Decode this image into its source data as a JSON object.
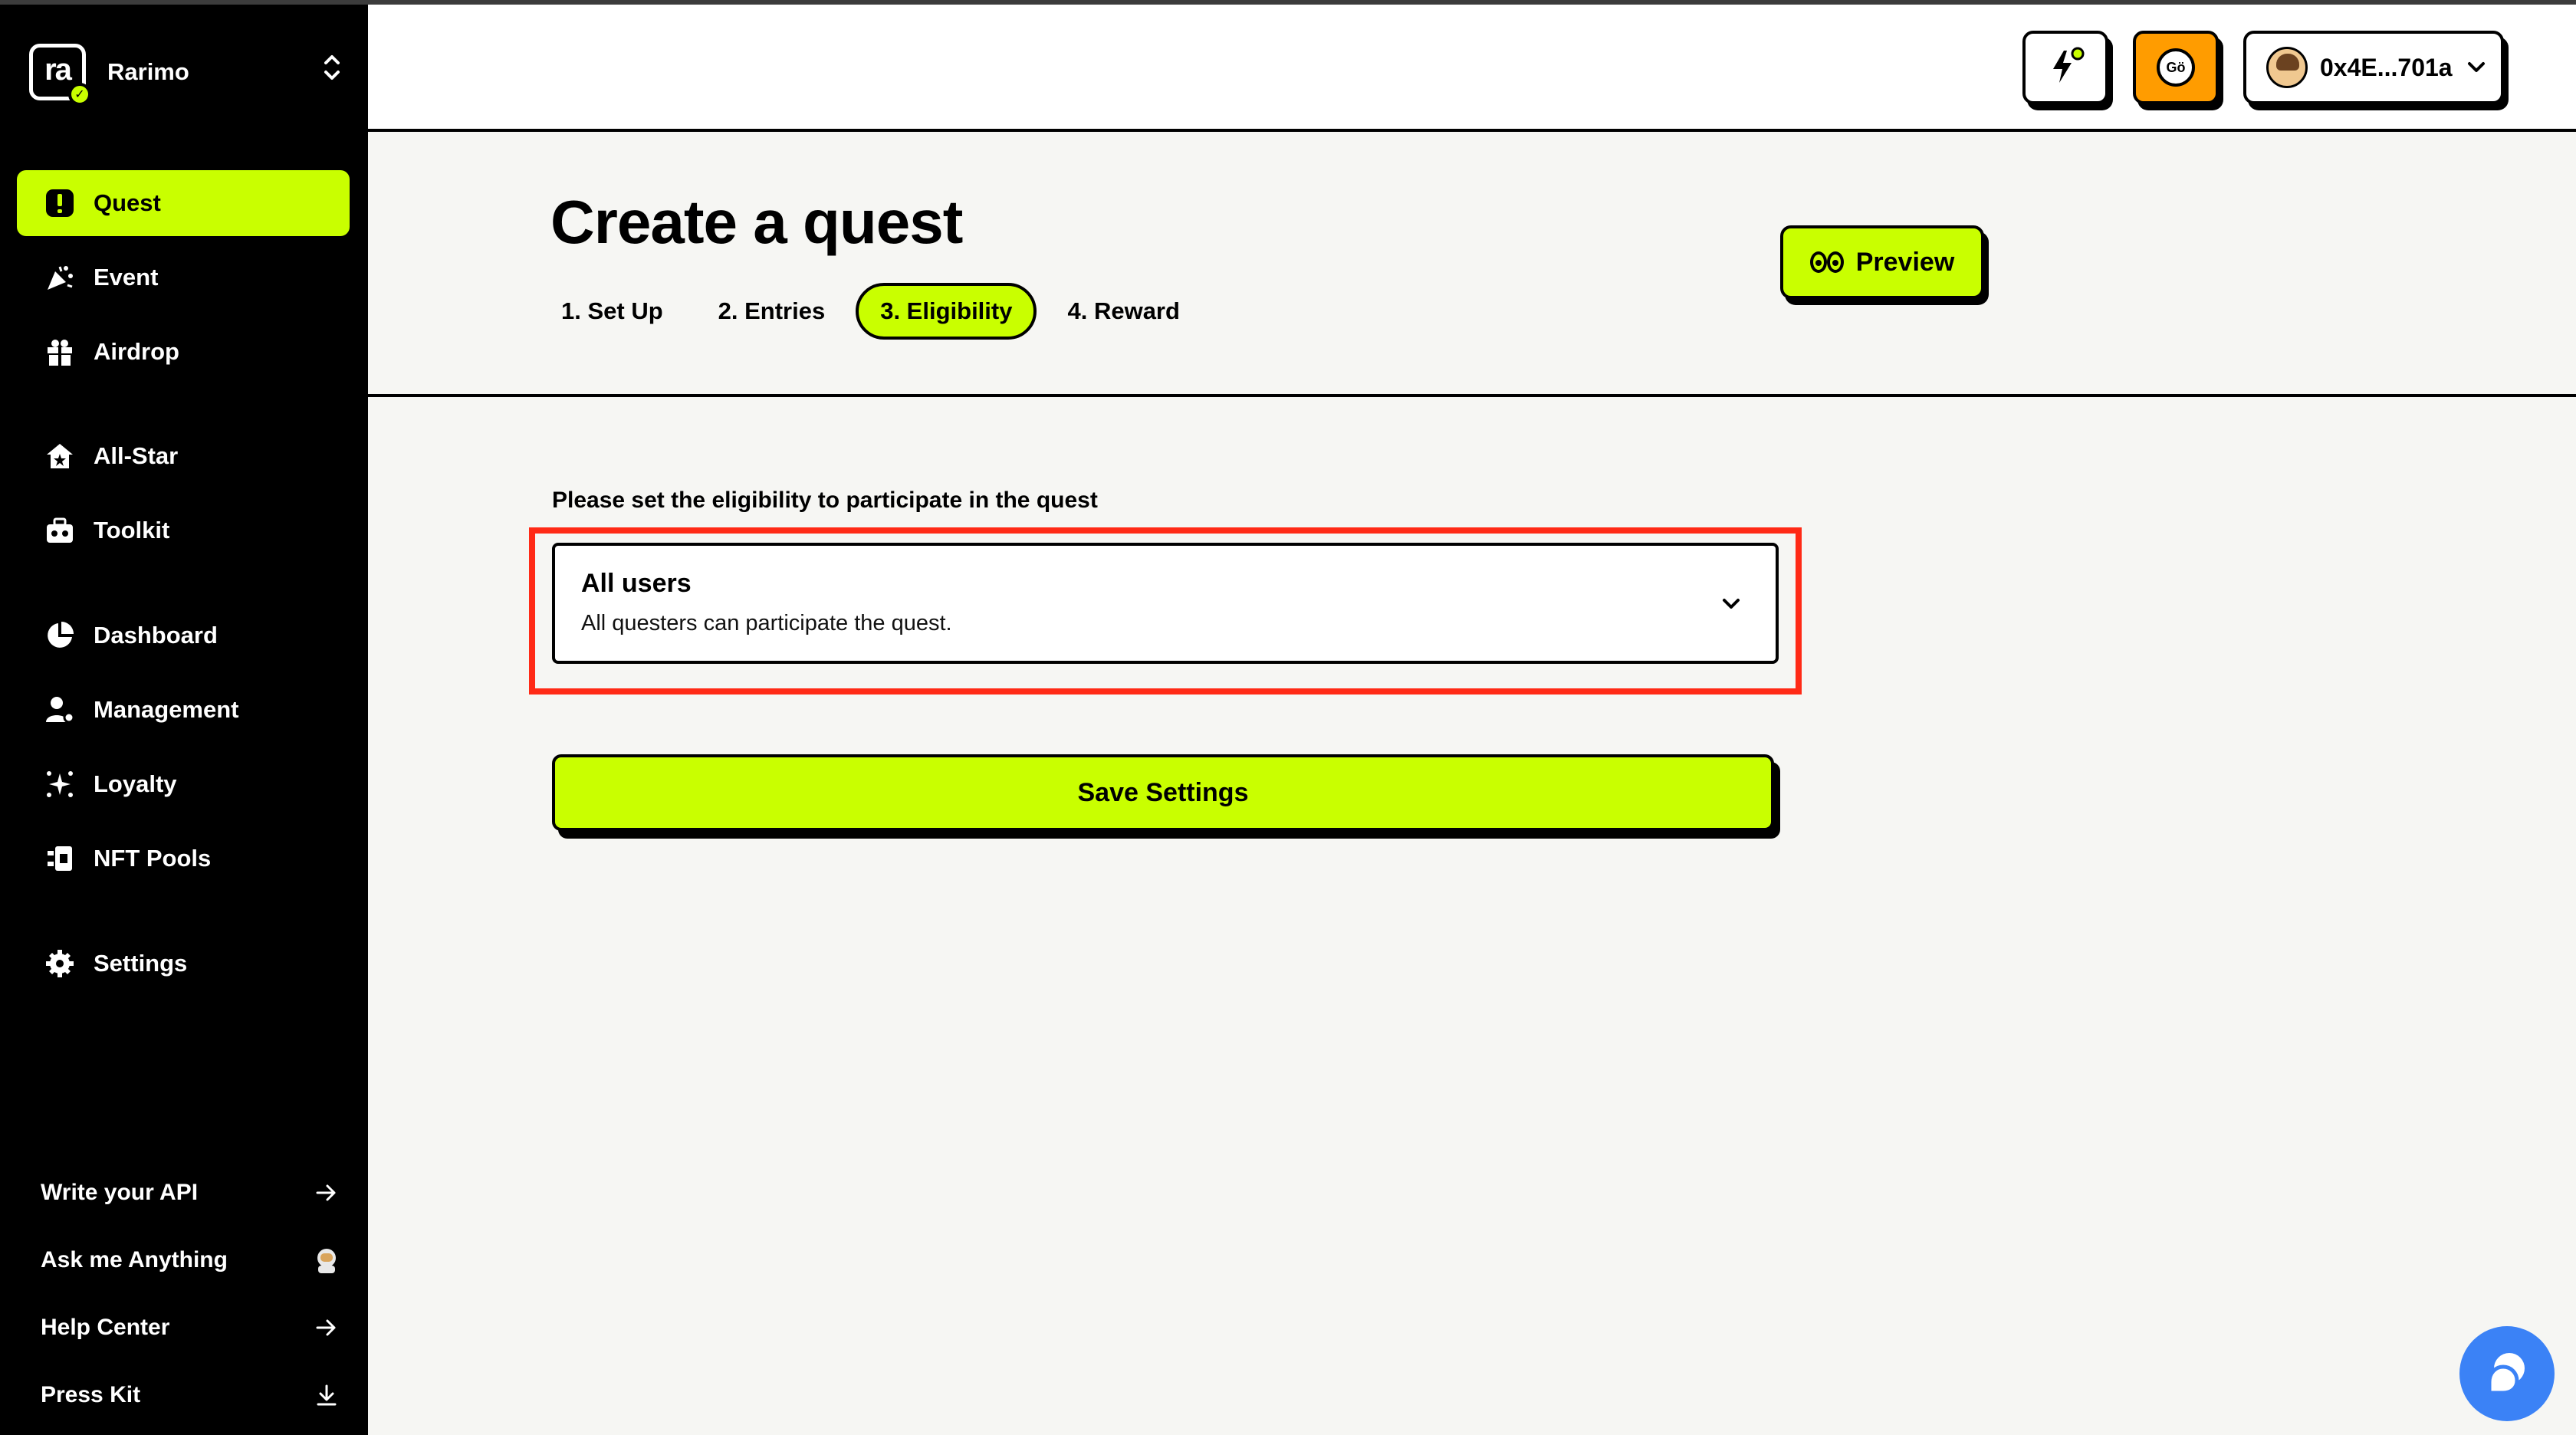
{
  "brand": {
    "logo_text": "ra",
    "name": "Rarimo"
  },
  "sidebar": {
    "items": [
      {
        "label": "Quest",
        "icon": "quest-icon",
        "active": true
      },
      {
        "label": "Event",
        "icon": "party-popper-icon"
      },
      {
        "label": "Airdrop",
        "icon": "gift-icon"
      },
      {
        "label": "All-Star",
        "icon": "star-house-icon"
      },
      {
        "label": "Toolkit",
        "icon": "toolbox-icon"
      },
      {
        "label": "Dashboard",
        "icon": "pie-chart-icon"
      },
      {
        "label": "Management",
        "icon": "user-gear-icon"
      },
      {
        "label": "Loyalty",
        "icon": "sparkle-icon"
      },
      {
        "label": "NFT Pools",
        "icon": "nft-pool-icon"
      },
      {
        "label": "Settings",
        "icon": "gear-icon"
      }
    ],
    "bottom_links": [
      {
        "label": "Write your API",
        "icon": "arrow-right-icon"
      },
      {
        "label": "Ask me Anything",
        "icon": "astronaut-icon"
      },
      {
        "label": "Help Center",
        "icon": "arrow-right-icon"
      },
      {
        "label": "Press Kit",
        "icon": "download-icon"
      }
    ]
  },
  "topbar": {
    "coin_label": "Gö",
    "wallet_address": "0x4E...701a"
  },
  "header": {
    "title": "Create a quest",
    "steps": [
      {
        "label": "1. Set Up",
        "active": false
      },
      {
        "label": "2. Entries",
        "active": false
      },
      {
        "label": "3. Eligibility",
        "active": true
      },
      {
        "label": "4. Reward",
        "active": false
      }
    ],
    "preview_label": "Preview"
  },
  "form": {
    "label": "Please set the eligibility to participate in the quest",
    "select": {
      "title": "All users",
      "description": "All questers can participate the quest."
    },
    "save_label": "Save Settings"
  },
  "colors": {
    "accent": "#c9ff00",
    "sidebar_bg": "#000000",
    "content_bg": "#f6f6f3",
    "highlight": "#ff2a16",
    "coin": "#ff9c00",
    "chat": "#3b82f6"
  }
}
